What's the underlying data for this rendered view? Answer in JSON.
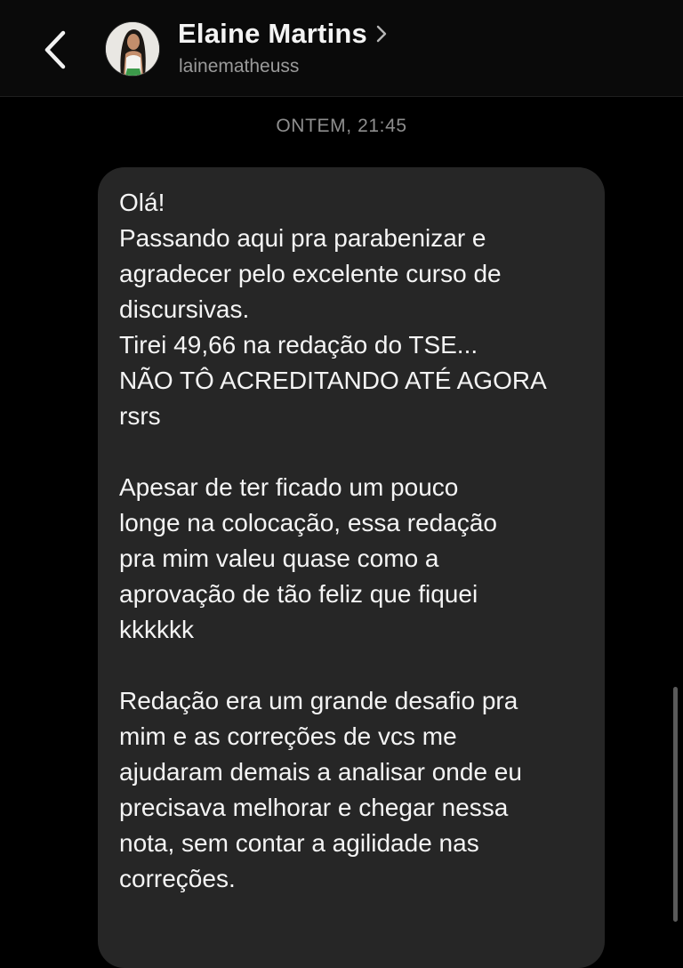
{
  "header": {
    "contact_name": "Elaine Martins",
    "username": "lainematheuss",
    "back_icon": "chevron-left-icon",
    "name_chevron_icon": "chevron-right-icon"
  },
  "chat": {
    "timestamp": "ONTEM, 21:45",
    "message": {
      "paragraphs": [
        "Olá!\nPassando aqui pra parabenizar e\nagradecer pelo excelente curso de\ndiscursivas.\nTirei 49,66 na redação do TSE...\nNÃO TÔ ACREDITANDO ATÉ AGORA\nrsrs",
        "Apesar de ter ficado um pouco\nlonge na colocação, essa redação\npra mim valeu quase como a\naprovação de tão feliz que fiquei\nkkkkkk",
        "Redação era um grande desafio pra\nmim e as correções de vcs me\najudaram demais a analisar onde eu\nprecisava melhorar e chegar nessa\nnota, sem contar a agilidade nas\ncorreções."
      ]
    }
  },
  "colors": {
    "background": "#000000",
    "header_background": "#0a0a0a",
    "bubble": "#262626",
    "text": "#f4f4f4",
    "secondary_text": "#9a9a9a",
    "timestamp": "#8e8e8e"
  }
}
